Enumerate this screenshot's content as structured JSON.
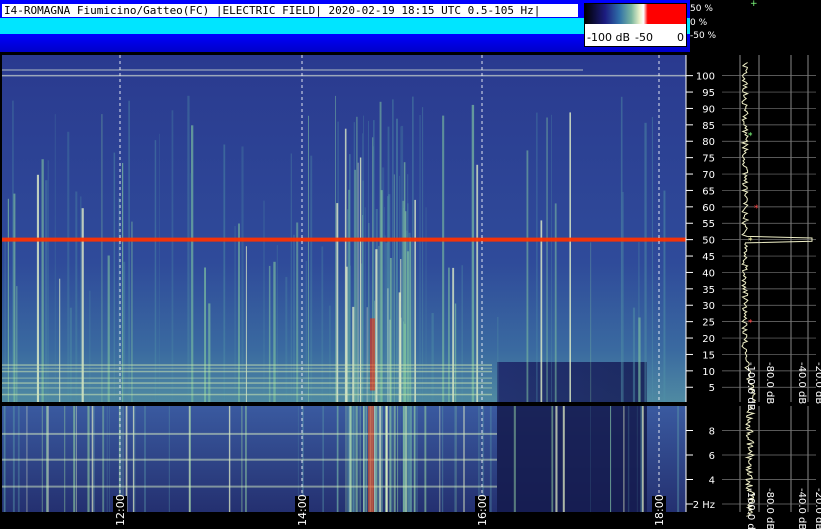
{
  "header": {
    "title": "I4-ROMAGNA Fiumicino/Gatteo(FC) |ELECTRIC FIELD| 2020-02-19 18:15 UTC 0.5-105 Hz|"
  },
  "colorbar": {
    "labels": [
      "-100 dB",
      "-50",
      "0"
    ]
  },
  "level_scale": {
    "labels": [
      "50 %",
      "0 %",
      "-50 %"
    ]
  },
  "chart_data": [
    {
      "type": "heatmap",
      "name": "main-spectrogram",
      "y_unit": "",
      "ylim": [
        0,
        105
      ],
      "yticks": [
        "100",
        "95",
        "90",
        "85",
        "80",
        "75",
        "70",
        "65",
        "60",
        "55",
        "50",
        "45",
        "40",
        "35",
        "30",
        "25",
        "20",
        "15",
        "10",
        "5"
      ],
      "ytick_values": [
        100,
        95,
        90,
        85,
        80,
        75,
        70,
        65,
        60,
        55,
        50,
        45,
        40,
        35,
        30,
        25,
        20,
        15,
        10,
        5
      ],
      "bright_lines_hz": [
        50,
        100
      ],
      "xticks": [
        "12:00",
        "14:00",
        "16:00",
        "18:00"
      ]
    },
    {
      "type": "heatmap",
      "name": "zoom-spectrogram",
      "ylim": [
        0.5,
        10
      ],
      "yticks": [
        "8",
        "6",
        "4",
        "2 Hz"
      ],
      "ytick_values": [
        8,
        6,
        4,
        2
      ],
      "xticks": [
        "12:00",
        "14:00",
        "16:00",
        "18:00"
      ]
    },
    {
      "type": "line",
      "name": "main-spectrum",
      "x_ticks": [
        "-100.0 dB",
        "-80.0 dB",
        "-40.0 dB",
        "-20.0 dB"
      ],
      "peak_hz": [
        50,
        60,
        25,
        82
      ]
    },
    {
      "type": "line",
      "name": "zoom-spectrum",
      "x_ticks": [
        "-100.0 dB",
        "-80.0 dB",
        "-40.0 dB",
        "-20.0 dB"
      ]
    }
  ],
  "colors": {
    "background": "#000000",
    "spectrogram_base": "#2b3a94",
    "mains_line": "#ff3300",
    "grid": "#ffffff"
  }
}
